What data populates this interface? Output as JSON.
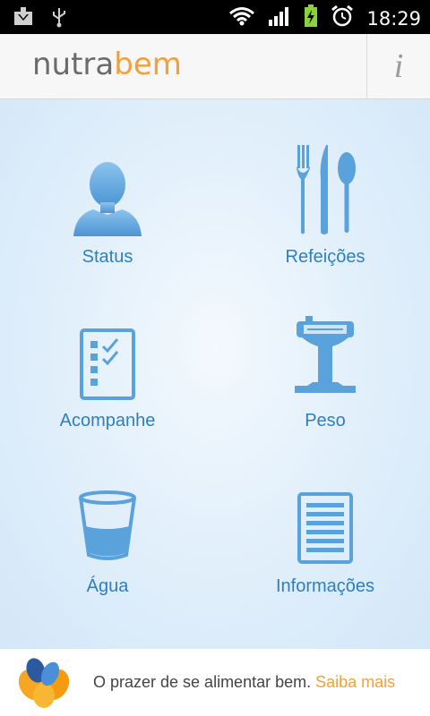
{
  "statusbar": {
    "time": "18:29",
    "icons": [
      "download-icon",
      "usb-icon",
      "wifi-icon",
      "signal-icon",
      "battery-charging-icon",
      "alarm-icon"
    ]
  },
  "header": {
    "logo_part1": "nutra",
    "logo_part2": "bem",
    "info_label": "i"
  },
  "menu": {
    "status": "Status",
    "refeicoes": "Refeições",
    "acompanhe": "Acompanhe",
    "peso": "Peso",
    "agua": "Água",
    "informacoes": "Informações"
  },
  "ad": {
    "text": "O prazer de se alimentar bem.",
    "link": "Saiba mais"
  },
  "colors": {
    "accent_blue": "#2f7fc0",
    "icon_blue": "#5aa2dc",
    "brand_orange": "#f2a03b"
  }
}
